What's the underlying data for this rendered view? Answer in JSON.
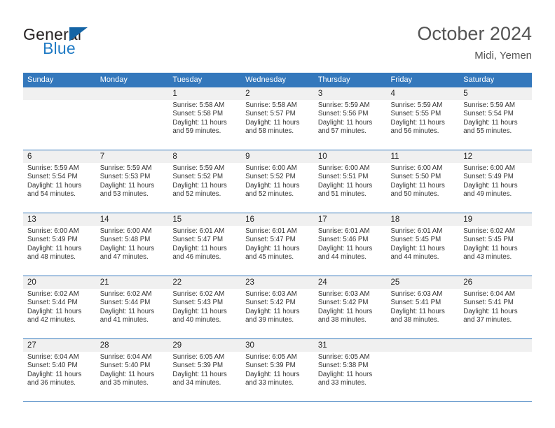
{
  "brand": {
    "name_part1": "General",
    "name_part2": "Blue",
    "accent_color": "#1f7ac4",
    "triangle_color": "#1464a5"
  },
  "header": {
    "title": "October 2024",
    "subtitle": "Midi, Yemen"
  },
  "calendar": {
    "header_bg": "#3478bc",
    "daynum_bg": "#f0f0f0",
    "weekdays": [
      "Sunday",
      "Monday",
      "Tuesday",
      "Wednesday",
      "Thursday",
      "Friday",
      "Saturday"
    ],
    "weeks": [
      [
        {
          "day": "",
          "sunrise": "",
          "sunset": "",
          "daylight1": "",
          "daylight2": "",
          "empty": true
        },
        {
          "day": "",
          "sunrise": "",
          "sunset": "",
          "daylight1": "",
          "daylight2": "",
          "empty": true
        },
        {
          "day": "1",
          "sunrise": "Sunrise: 5:58 AM",
          "sunset": "Sunset: 5:58 PM",
          "daylight1": "Daylight: 11 hours",
          "daylight2": "and 59 minutes."
        },
        {
          "day": "2",
          "sunrise": "Sunrise: 5:58 AM",
          "sunset": "Sunset: 5:57 PM",
          "daylight1": "Daylight: 11 hours",
          "daylight2": "and 58 minutes."
        },
        {
          "day": "3",
          "sunrise": "Sunrise: 5:59 AM",
          "sunset": "Sunset: 5:56 PM",
          "daylight1": "Daylight: 11 hours",
          "daylight2": "and 57 minutes."
        },
        {
          "day": "4",
          "sunrise": "Sunrise: 5:59 AM",
          "sunset": "Sunset: 5:55 PM",
          "daylight1": "Daylight: 11 hours",
          "daylight2": "and 56 minutes."
        },
        {
          "day": "5",
          "sunrise": "Sunrise: 5:59 AM",
          "sunset": "Sunset: 5:54 PM",
          "daylight1": "Daylight: 11 hours",
          "daylight2": "and 55 minutes."
        }
      ],
      [
        {
          "day": "6",
          "sunrise": "Sunrise: 5:59 AM",
          "sunset": "Sunset: 5:54 PM",
          "daylight1": "Daylight: 11 hours",
          "daylight2": "and 54 minutes."
        },
        {
          "day": "7",
          "sunrise": "Sunrise: 5:59 AM",
          "sunset": "Sunset: 5:53 PM",
          "daylight1": "Daylight: 11 hours",
          "daylight2": "and 53 minutes."
        },
        {
          "day": "8",
          "sunrise": "Sunrise: 5:59 AM",
          "sunset": "Sunset: 5:52 PM",
          "daylight1": "Daylight: 11 hours",
          "daylight2": "and 52 minutes."
        },
        {
          "day": "9",
          "sunrise": "Sunrise: 6:00 AM",
          "sunset": "Sunset: 5:52 PM",
          "daylight1": "Daylight: 11 hours",
          "daylight2": "and 52 minutes."
        },
        {
          "day": "10",
          "sunrise": "Sunrise: 6:00 AM",
          "sunset": "Sunset: 5:51 PM",
          "daylight1": "Daylight: 11 hours",
          "daylight2": "and 51 minutes."
        },
        {
          "day": "11",
          "sunrise": "Sunrise: 6:00 AM",
          "sunset": "Sunset: 5:50 PM",
          "daylight1": "Daylight: 11 hours",
          "daylight2": "and 50 minutes."
        },
        {
          "day": "12",
          "sunrise": "Sunrise: 6:00 AM",
          "sunset": "Sunset: 5:49 PM",
          "daylight1": "Daylight: 11 hours",
          "daylight2": "and 49 minutes."
        }
      ],
      [
        {
          "day": "13",
          "sunrise": "Sunrise: 6:00 AM",
          "sunset": "Sunset: 5:49 PM",
          "daylight1": "Daylight: 11 hours",
          "daylight2": "and 48 minutes."
        },
        {
          "day": "14",
          "sunrise": "Sunrise: 6:00 AM",
          "sunset": "Sunset: 5:48 PM",
          "daylight1": "Daylight: 11 hours",
          "daylight2": "and 47 minutes."
        },
        {
          "day": "15",
          "sunrise": "Sunrise: 6:01 AM",
          "sunset": "Sunset: 5:47 PM",
          "daylight1": "Daylight: 11 hours",
          "daylight2": "and 46 minutes."
        },
        {
          "day": "16",
          "sunrise": "Sunrise: 6:01 AM",
          "sunset": "Sunset: 5:47 PM",
          "daylight1": "Daylight: 11 hours",
          "daylight2": "and 45 minutes."
        },
        {
          "day": "17",
          "sunrise": "Sunrise: 6:01 AM",
          "sunset": "Sunset: 5:46 PM",
          "daylight1": "Daylight: 11 hours",
          "daylight2": "and 44 minutes."
        },
        {
          "day": "18",
          "sunrise": "Sunrise: 6:01 AM",
          "sunset": "Sunset: 5:45 PM",
          "daylight1": "Daylight: 11 hours",
          "daylight2": "and 44 minutes."
        },
        {
          "day": "19",
          "sunrise": "Sunrise: 6:02 AM",
          "sunset": "Sunset: 5:45 PM",
          "daylight1": "Daylight: 11 hours",
          "daylight2": "and 43 minutes."
        }
      ],
      [
        {
          "day": "20",
          "sunrise": "Sunrise: 6:02 AM",
          "sunset": "Sunset: 5:44 PM",
          "daylight1": "Daylight: 11 hours",
          "daylight2": "and 42 minutes."
        },
        {
          "day": "21",
          "sunrise": "Sunrise: 6:02 AM",
          "sunset": "Sunset: 5:44 PM",
          "daylight1": "Daylight: 11 hours",
          "daylight2": "and 41 minutes."
        },
        {
          "day": "22",
          "sunrise": "Sunrise: 6:02 AM",
          "sunset": "Sunset: 5:43 PM",
          "daylight1": "Daylight: 11 hours",
          "daylight2": "and 40 minutes."
        },
        {
          "day": "23",
          "sunrise": "Sunrise: 6:03 AM",
          "sunset": "Sunset: 5:42 PM",
          "daylight1": "Daylight: 11 hours",
          "daylight2": "and 39 minutes."
        },
        {
          "day": "24",
          "sunrise": "Sunrise: 6:03 AM",
          "sunset": "Sunset: 5:42 PM",
          "daylight1": "Daylight: 11 hours",
          "daylight2": "and 38 minutes."
        },
        {
          "day": "25",
          "sunrise": "Sunrise: 6:03 AM",
          "sunset": "Sunset: 5:41 PM",
          "daylight1": "Daylight: 11 hours",
          "daylight2": "and 38 minutes."
        },
        {
          "day": "26",
          "sunrise": "Sunrise: 6:04 AM",
          "sunset": "Sunset: 5:41 PM",
          "daylight1": "Daylight: 11 hours",
          "daylight2": "and 37 minutes."
        }
      ],
      [
        {
          "day": "27",
          "sunrise": "Sunrise: 6:04 AM",
          "sunset": "Sunset: 5:40 PM",
          "daylight1": "Daylight: 11 hours",
          "daylight2": "and 36 minutes."
        },
        {
          "day": "28",
          "sunrise": "Sunrise: 6:04 AM",
          "sunset": "Sunset: 5:40 PM",
          "daylight1": "Daylight: 11 hours",
          "daylight2": "and 35 minutes."
        },
        {
          "day": "29",
          "sunrise": "Sunrise: 6:05 AM",
          "sunset": "Sunset: 5:39 PM",
          "daylight1": "Daylight: 11 hours",
          "daylight2": "and 34 minutes."
        },
        {
          "day": "30",
          "sunrise": "Sunrise: 6:05 AM",
          "sunset": "Sunset: 5:39 PM",
          "daylight1": "Daylight: 11 hours",
          "daylight2": "and 33 minutes."
        },
        {
          "day": "31",
          "sunrise": "Sunrise: 6:05 AM",
          "sunset": "Sunset: 5:38 PM",
          "daylight1": "Daylight: 11 hours",
          "daylight2": "and 33 minutes."
        },
        {
          "day": "",
          "sunrise": "",
          "sunset": "",
          "daylight1": "",
          "daylight2": "",
          "empty": true
        },
        {
          "day": "",
          "sunrise": "",
          "sunset": "",
          "daylight1": "",
          "daylight2": "",
          "empty": true
        }
      ]
    ]
  }
}
